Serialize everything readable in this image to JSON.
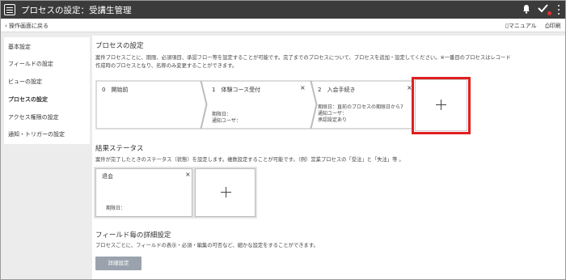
{
  "header": {
    "title": "プロセスの設定：受講生管理",
    "icons": [
      "menu-icon",
      "bell-icon",
      "check-icon",
      "more-icon"
    ],
    "notification_color": "#e63030"
  },
  "subbar": {
    "back_label": "操作画面に戻る",
    "manual_label": "マニュアル",
    "print_label": "印刷"
  },
  "sidebar": {
    "items": [
      {
        "label": "基本設定"
      },
      {
        "label": "フィールドの設定"
      },
      {
        "label": "ビューの設定"
      },
      {
        "label": "プロセスの設定",
        "active": true
      },
      {
        "label": "アクセス権限の設定"
      },
      {
        "label": "通知・トリガーの設定"
      }
    ]
  },
  "process": {
    "title": "プロセスの設定",
    "description": [
      "案件プロセスごとに、期限、必須項目、承認フロー等を設定することが可能です。完了までのプロセスについて、プロセスを追加・設定してください。※一番目のプロセスはレコード",
      "作成時のプロセスとなり、名称のみ変更することができます。"
    ],
    "steps": [
      {
        "label": "0　開始前",
        "lines": []
      },
      {
        "label": "1　体験コース受付",
        "lines": [
          "期限日：",
          "通知ユーザ："
        ]
      },
      {
        "label": "2　入会手続き",
        "lines": [
          "期限日：直前のプロセスの期限日から7",
          "通知ユーザ：",
          "承認設定あり"
        ]
      }
    ]
  },
  "result": {
    "title": "結果ステータス",
    "description": "案件が完了したときのステータス（状態）を設定します。複数設定することが可能です。（例）営業プロセスの「受注」と「失注」等 。",
    "cards": [
      {
        "label": "退会",
        "deadline": "期限日："
      }
    ]
  },
  "field_detail": {
    "title": "フィールド毎の詳細設定",
    "description": "プロセスごとに、フィールドの表示・必須・編集の可否など、細かな設定をすることができます。",
    "button_label": "詳細設定"
  },
  "accent_highlight": "#e02020"
}
